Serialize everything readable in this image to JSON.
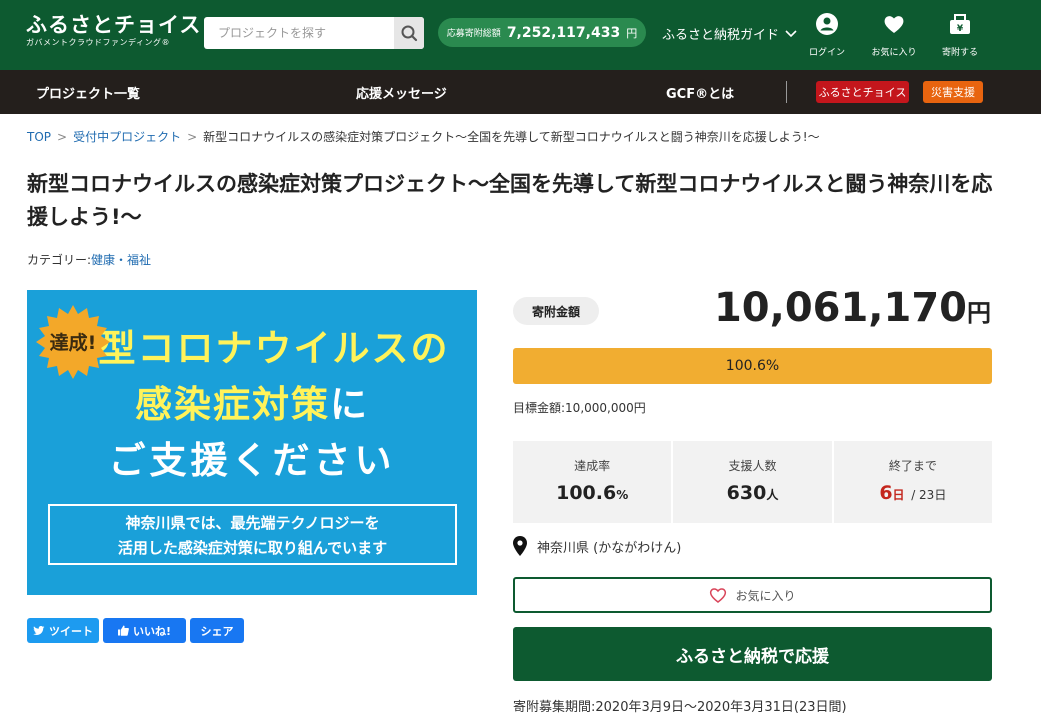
{
  "header": {
    "logo_main": "ふるさとチョイス",
    "logo_sub": "ガバメントクラウドファンディング®",
    "search_placeholder": "プロジェクトを探す",
    "total_label": "応募寄附総額",
    "total_value": "7,252,117,433",
    "total_unit": "円",
    "guide_label": "ふるさと納税ガイド",
    "icons": [
      {
        "label": "ログイン",
        "icon": "user-icon"
      },
      {
        "label": "お気に入り",
        "icon": "heart-icon"
      },
      {
        "label": "寄附する",
        "icon": "donate-box-icon"
      }
    ]
  },
  "nav": {
    "items": [
      "プロジェクト一覧",
      "応援メッセージ",
      "GCF®とは"
    ],
    "badges": [
      {
        "label": "ふるさとチョイス",
        "color": "#c4161c"
      },
      {
        "label": "災害支援",
        "color": "#e8640f"
      }
    ]
  },
  "breadcrumb": {
    "top": "TOP",
    "middle": "受付中プロジェクト",
    "current": "新型コロナウイルスの感染症対策プロジェクト～全国を先導して新型コロナウイルスと闘う神奈川を応援しよう!～"
  },
  "project": {
    "title": "新型コロナウイルスの感染症対策プロジェクト～全国を先導して新型コロナウイルスと闘う神奈川を応援しよう!～",
    "category_label": "カテゴリー:",
    "category_value": "健康・福祉"
  },
  "banner": {
    "badge": "達成!",
    "line1": "型コロナウイルスの",
    "line2_highlight": "感染症対策",
    "line2_rest": "に",
    "line3": "ご支援ください",
    "box_line1": "神奈川県では、最先端テクノロジーを",
    "box_line2": "活用した感染症対策に取り組んでいます"
  },
  "share": {
    "tweet": "ツイート",
    "like": "いいね!",
    "share": "シェア"
  },
  "funding": {
    "label": "寄附金額",
    "amount": "10,061,170",
    "unit": "円",
    "progress_text": "100.6%",
    "progress_fraction": 1.0,
    "target": "目標金額:10,000,000円",
    "stats": {
      "rate_label": "達成率",
      "rate_value": "100.6",
      "rate_unit": "%",
      "supporters_label": "支援人数",
      "supporters_value": "630",
      "supporters_unit": "人",
      "remaining_label": "終了まで",
      "remaining_value": "6",
      "remaining_unit": "日",
      "remaining_total": "/ 23日"
    },
    "location": "神奈川県 (かながわけん)",
    "favorite_label": "お気に入り",
    "donate_label": "ふるさと納税で応援",
    "period": "寄附募集期間:2020年3月9日～2020年3月31日(23日間)"
  },
  "colors": {
    "header_green": "#0d5a30",
    "nav_dark": "#241f1c",
    "progress_orange": "#f1ad31",
    "banner_blue": "#1aa0d9",
    "link_blue": "#1f6bb0"
  }
}
